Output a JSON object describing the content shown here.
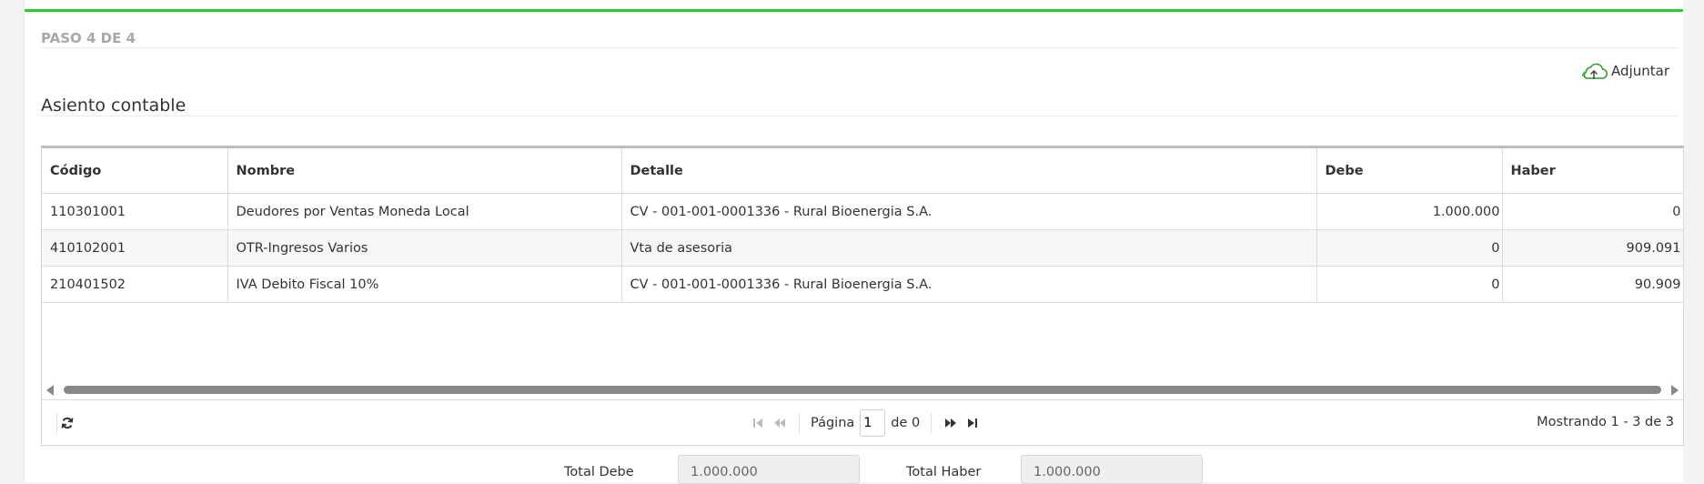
{
  "step": {
    "title": "PASO 4 DE 4"
  },
  "attach": {
    "label": "Adjuntar"
  },
  "section": {
    "title": "Asiento contable"
  },
  "table": {
    "columns": [
      "Código",
      "Nombre",
      "Detalle",
      "Debe",
      "Haber"
    ],
    "rows": [
      {
        "codigo": "110301001",
        "nombre": "Deudores por Ventas Moneda Local",
        "detalle": "CV - 001-001-0001336 - Rural Bioenergia S.A.",
        "debe": "1.000.000",
        "haber": "0"
      },
      {
        "codigo": "410102001",
        "nombre": "OTR-Ingresos Varios",
        "detalle": "Vta de asesoria",
        "debe": "0",
        "haber": "909.091"
      },
      {
        "codigo": "210401502",
        "nombre": "IVA Debito Fiscal 10%",
        "detalle": "CV - 001-001-0001336 - Rural Bioenergia S.A.",
        "debe": "0",
        "haber": "90.909"
      }
    ]
  },
  "pager": {
    "page_label": "Página",
    "page_value": "1",
    "of_label": "de 0",
    "showing": "Mostrando 1 - 3 de 3"
  },
  "totals": {
    "debe_label": "Total Debe",
    "debe_value": "1.000.000",
    "haber_label": "Total Haber",
    "haber_value": "1.000.000"
  },
  "colors": {
    "accent": "#2ecc2e"
  }
}
